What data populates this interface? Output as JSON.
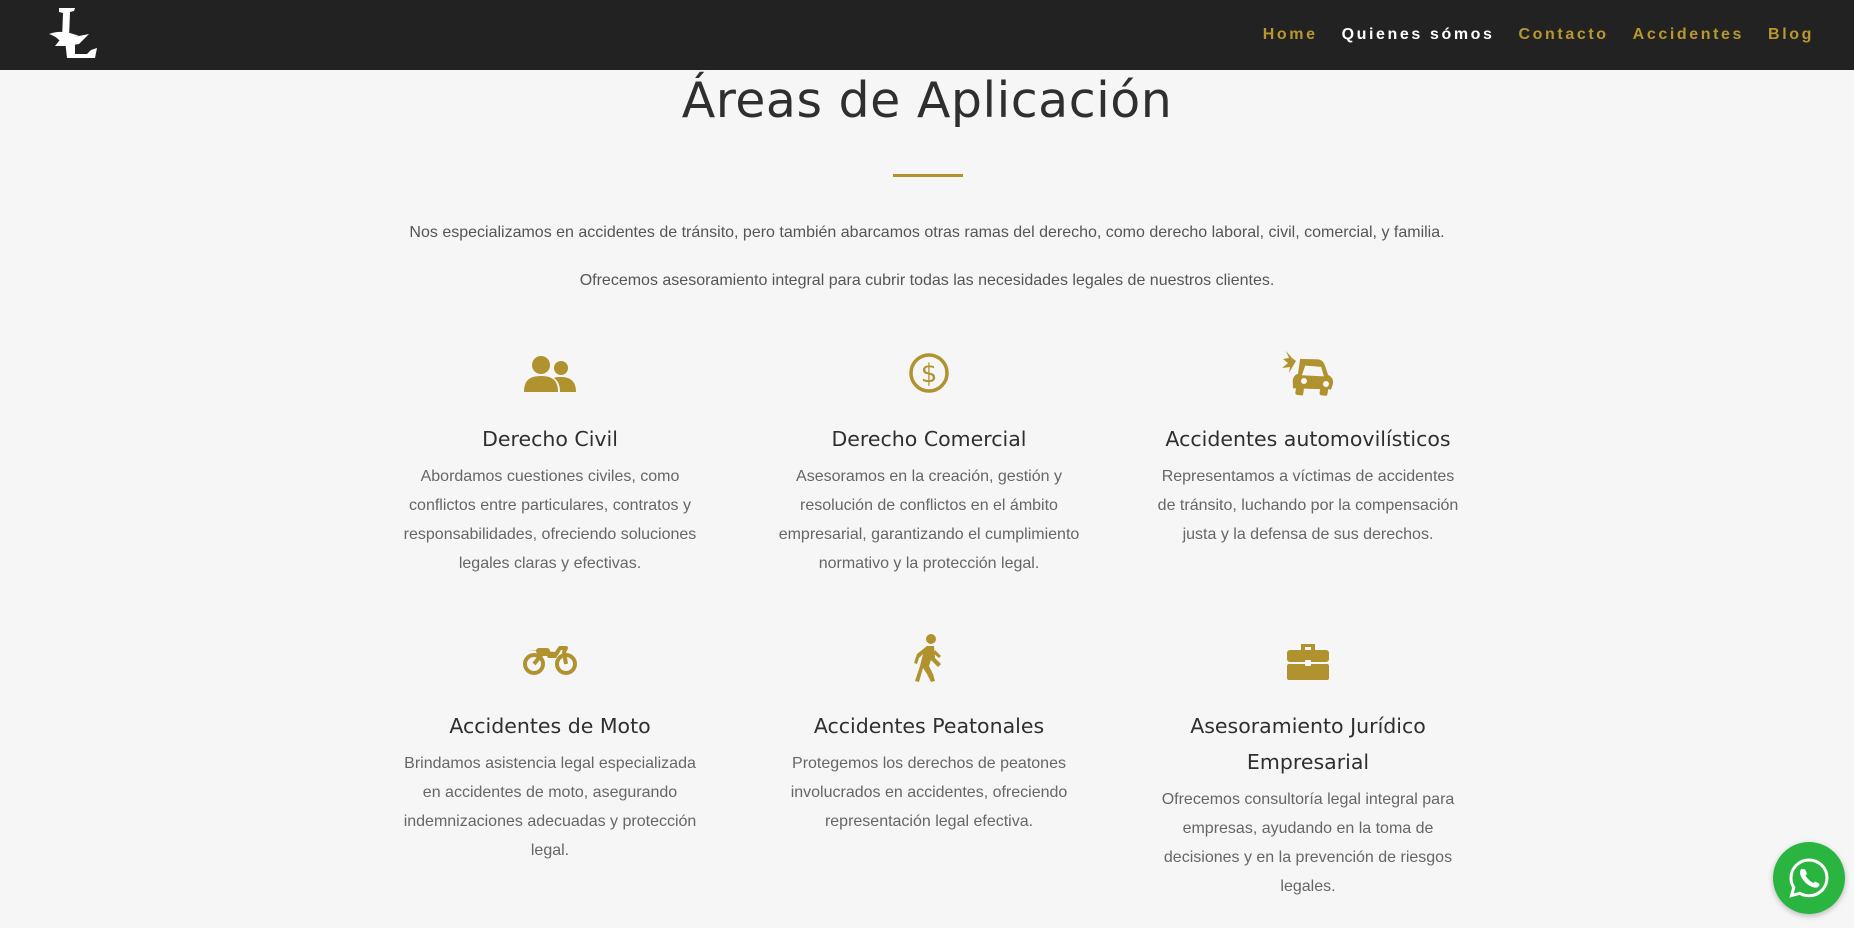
{
  "header": {
    "logo_alt": "L",
    "nav": [
      {
        "label": "Home"
      },
      {
        "label": "Quienes sómos"
      },
      {
        "label": "Contacto"
      },
      {
        "label": "Accidentes"
      },
      {
        "label": "Blog"
      }
    ],
    "active_item": "Quienes sómos"
  },
  "section": {
    "title": "Áreas de Aplicación",
    "intro_1": "Nos especializamos en accidentes de tránsito, pero también abarcamos otras ramas del derecho, como derecho laboral, civil, comercial, y familia.",
    "intro_2": "Ofrecemos asesoramiento integral para cubrir todas las necesidades legales de nuestros clientes."
  },
  "cards": [
    {
      "icon": "users-icon",
      "title": "Derecho Civil",
      "text": "Abordamos cuestiones civiles, como conflictos entre particulares, contratos y responsabilidades, ofreciendo soluciones legales claras y efectivas."
    },
    {
      "icon": "dollar-circle-icon",
      "title": "Derecho Comercial",
      "text": "Asesoramos en la creación, gestión y resolución de conflictos en el ámbito empresarial, garantizando el cumplimiento normativo y la protección legal."
    },
    {
      "icon": "car-crash-icon",
      "title": "Accidentes automovilísticos",
      "text": "Representamos a víctimas de accidentes de tránsito, luchando por la compensación justa y la defensa de sus derechos."
    },
    {
      "icon": "motorcycle-icon",
      "title": "Accidentes de Moto",
      "text": "Brindamos asistencia legal especializada en accidentes de moto, asegurando indemnizaciones adecuadas y protección legal."
    },
    {
      "icon": "pedestrian-icon",
      "title": "Accidentes Peatonales",
      "text": "Protegemos los derechos de peatones involucrados en accidentes, ofreciendo representación legal efectiva."
    },
    {
      "icon": "briefcase-icon",
      "title": "Asesoramiento Jurídico Empresarial",
      "text": "Ofrecemos consultoría legal integral para empresas, ayudando en la toma de decisiones y en la prevención de riesgos legales."
    }
  ],
  "colors": {
    "accent": "#b0922e",
    "header_bg": "#222222",
    "whatsapp": "#2ab540",
    "page_bg": "#f6f6f6"
  }
}
